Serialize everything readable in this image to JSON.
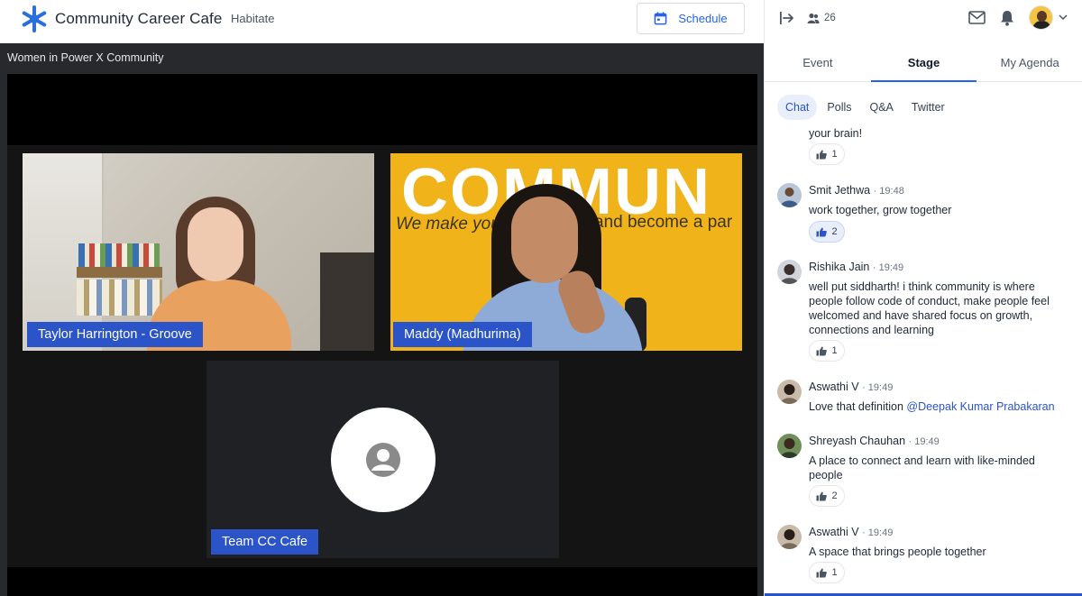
{
  "header": {
    "brand": "Community Career Cafe",
    "subbrand": "Habitate",
    "schedule_label": "Schedule"
  },
  "stage": {
    "title": "Women in Power X Community",
    "participants": [
      {
        "name": "Taylor Harrington - Groove"
      },
      {
        "name": "Maddy (Madhurima)"
      },
      {
        "name": "Team CC Cafe"
      }
    ],
    "banner_big": "COMMUN",
    "banner_left": "We make you",
    "banner_right": "and become a par"
  },
  "panel": {
    "people_count": "26",
    "tabs": [
      "Event",
      "Stage",
      "My Agenda"
    ],
    "active_tab": "Stage",
    "subtabs": [
      "Chat",
      "Polls",
      "Q&A",
      "Twitter"
    ],
    "active_subtab": "Chat"
  },
  "chat": {
    "partial": {
      "text": "your brain!",
      "likes": "1"
    },
    "messages": [
      {
        "name": "Smit Jethwa",
        "time": "· 19:48",
        "text": "work together, grow together",
        "likes": "2"
      },
      {
        "name": "Rishika Jain",
        "time": "· 19:49",
        "text": "well put siddharth! i think community is where people follow code of conduct, make people feel welcomed and have shared focus on growth, connections and learning",
        "likes": "1"
      },
      {
        "name": "Aswathi V",
        "time": "· 19:49",
        "text": "Love that definition ",
        "mention": "@Deepak Kumar Prabakaran"
      },
      {
        "name": "Shreyash Chauhan",
        "time": "· 19:49",
        "text": "A place to connect and learn with like-minded people",
        "likes": "2"
      },
      {
        "name": "Aswathi V",
        "time": "· 19:49",
        "text": "A space that brings people together",
        "likes": "1"
      }
    ]
  },
  "colors": {
    "accent": "#2563eb",
    "name_tag": "#2a54c8",
    "stage_bg": "#28292d",
    "banner": "#f0b31a"
  },
  "icons": {
    "logo": "snowflake-logo-icon",
    "schedule": "calendar-icon",
    "exit": "exit-stage-icon",
    "people": "people-icon",
    "mail": "mail-icon",
    "bell": "bell-icon",
    "caret": "chevron-down-icon",
    "reaction": "thumbs-up-icon",
    "placeholder": "user-placeholder-icon"
  }
}
